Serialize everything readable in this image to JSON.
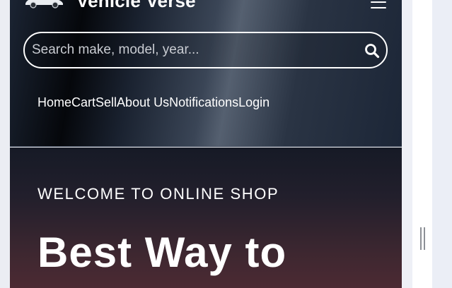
{
  "header": {
    "brand_title": "Vehicle Verse",
    "logo_icon": "car-logo-icon",
    "menu_icon": "hamburger-menu-icon"
  },
  "search": {
    "placeholder": "Search make, model, year...",
    "value": "",
    "icon": "search-icon"
  },
  "nav": {
    "items": [
      {
        "label": "Home"
      },
      {
        "label": "Cart"
      },
      {
        "label": "Sell"
      },
      {
        "label": "About Us"
      },
      {
        "label": "Notifications"
      },
      {
        "label": "Login"
      }
    ]
  },
  "hero": {
    "eyebrow": "WELCOME TO ONLINE SHOP",
    "heading": "Best Way to"
  },
  "colors": {
    "header_bg": "#1c2637",
    "hero_top": "#161a26",
    "hero_bottom": "#4c2a33",
    "text": "#ffffff",
    "page_bg": "#eef0f6"
  }
}
